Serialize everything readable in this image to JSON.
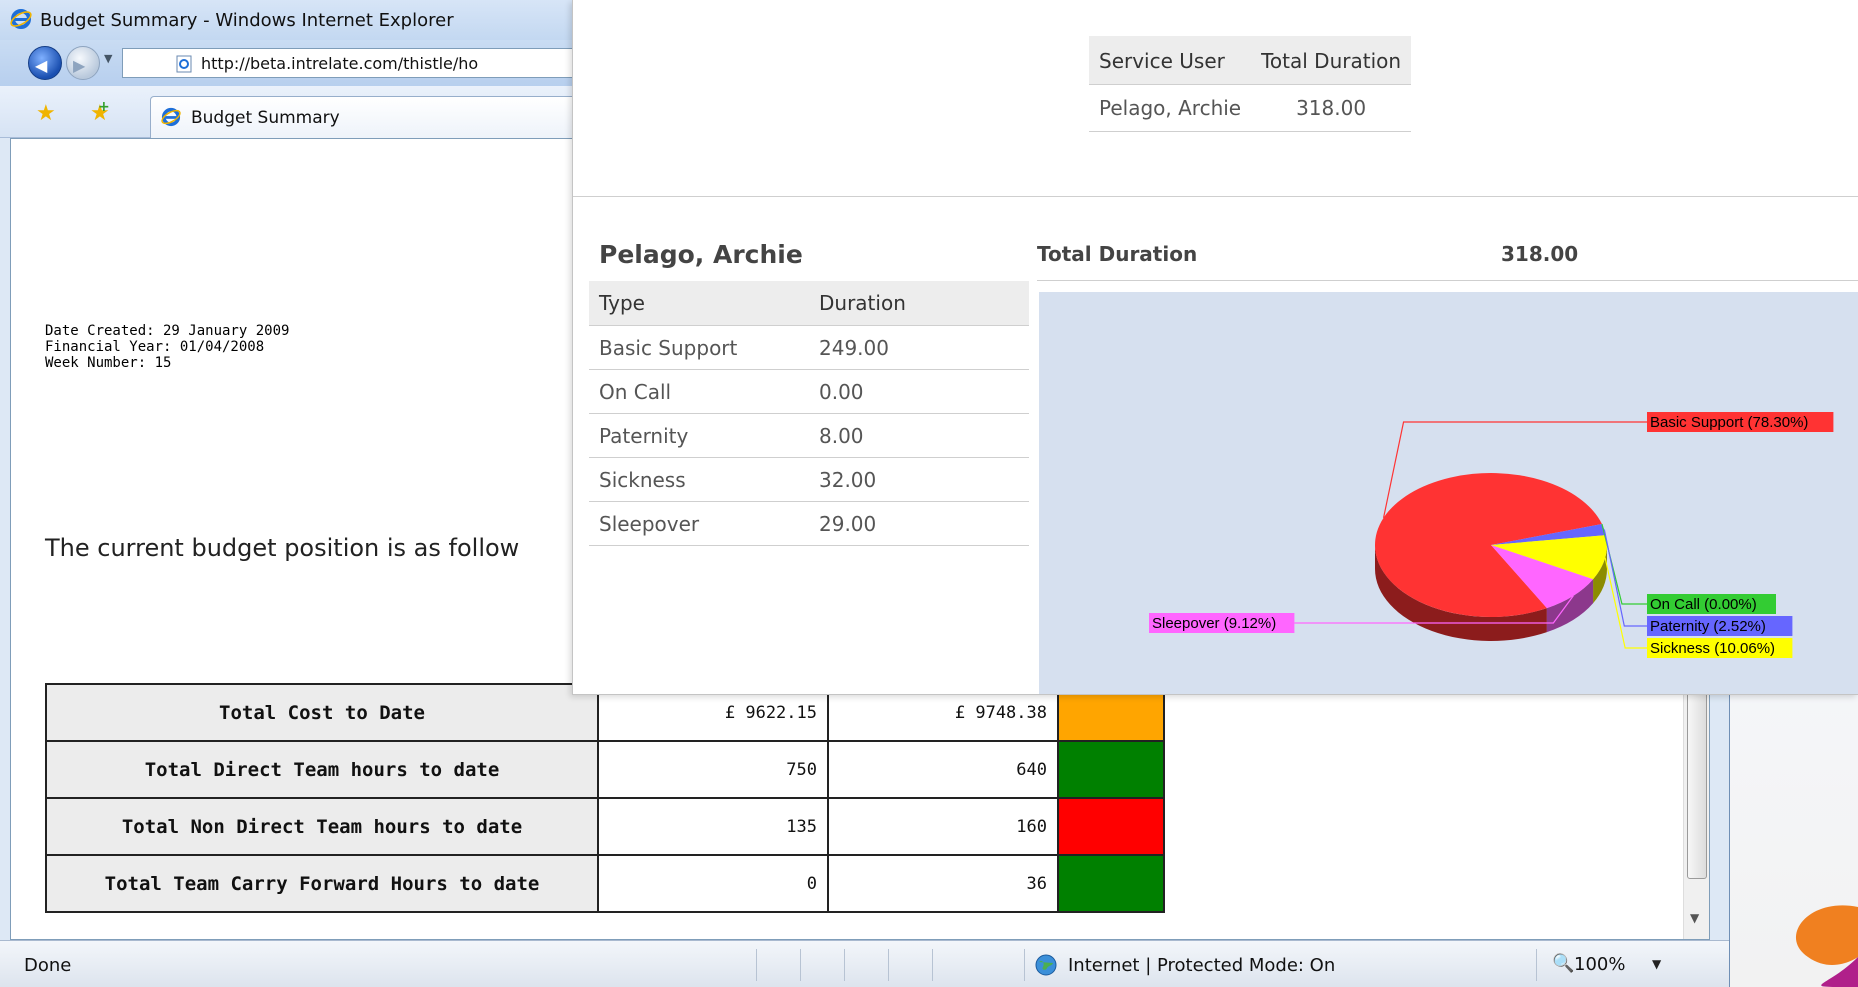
{
  "window": {
    "title": "Budget Summary - Windows Internet Explorer",
    "url": "http://beta.intrelate.com/thistle/ho",
    "tab_label": "Budget Summary"
  },
  "page": {
    "date_created": "Date Created: 29 January 2009",
    "financial_year": "Financial Year: 01/04/2008",
    "week_number": "Week Number: 15",
    "intro": "The current budget position is as follow"
  },
  "kpi_rows": [
    {
      "label": "Total Cost to Date",
      "val1": "£   9622.15",
      "val2": "£   9748.38",
      "status_color": "#ffa500"
    },
    {
      "label": "Total Direct Team hours to date",
      "val1": "750",
      "val2": "640",
      "status_color": "#008000"
    },
    {
      "label": "Total Non Direct Team hours to date",
      "val1": "135",
      "val2": "160",
      "status_color": "#ff0000"
    },
    {
      "label": "Total Team Carry Forward Hours to date",
      "val1": "0",
      "val2": "36",
      "status_color": "#008000"
    }
  ],
  "service_users": {
    "headers": [
      "Service User",
      "Total Duration"
    ],
    "rows": [
      [
        "Pelago, Archie",
        "318.00"
      ]
    ]
  },
  "detail": {
    "name": "Pelago, Archie",
    "total_label": "Total Duration",
    "total_value": "318.00",
    "headers": [
      "Type",
      "Duration"
    ],
    "rows": [
      [
        "Basic Support",
        "249.00"
      ],
      [
        "On Call",
        "0.00"
      ],
      [
        "Paternity",
        "8.00"
      ],
      [
        "Sickness",
        "32.00"
      ],
      [
        "Sleepover",
        "29.00"
      ]
    ]
  },
  "chart_data": {
    "type": "pie",
    "categories": [
      "Basic Support",
      "On Call",
      "Paternity",
      "Sickness",
      "Sleepover"
    ],
    "values": [
      78.3,
      0.0,
      2.52,
      10.06,
      9.12
    ],
    "labels": [
      "Basic Support (78.30%)",
      "On Call (0.00%)",
      "Paternity (2.52%)",
      "Sickness (10.06%)",
      "Sleepover (9.12%)"
    ],
    "colors": [
      "#ff3333",
      "#33cc33",
      "#6666ff",
      "#ffff00",
      "#ff66ff"
    ],
    "label_text_colors": [
      "#000000",
      "#000000",
      "#000000",
      "#000000",
      "#000000"
    ],
    "background": "#d6e0ef",
    "three_d": true
  },
  "status": {
    "left": "Done",
    "zone": "Internet | Protected Mode: On",
    "zoom": "100%"
  },
  "icons": {
    "back": "back-arrow-icon",
    "forward": "forward-arrow-icon",
    "ie": "internet-explorer-icon",
    "globe": "globe-icon",
    "zoom": "magnifier-icon",
    "favorites": "favorites-star-icon",
    "add_favorites": "add-favorites-icon"
  }
}
